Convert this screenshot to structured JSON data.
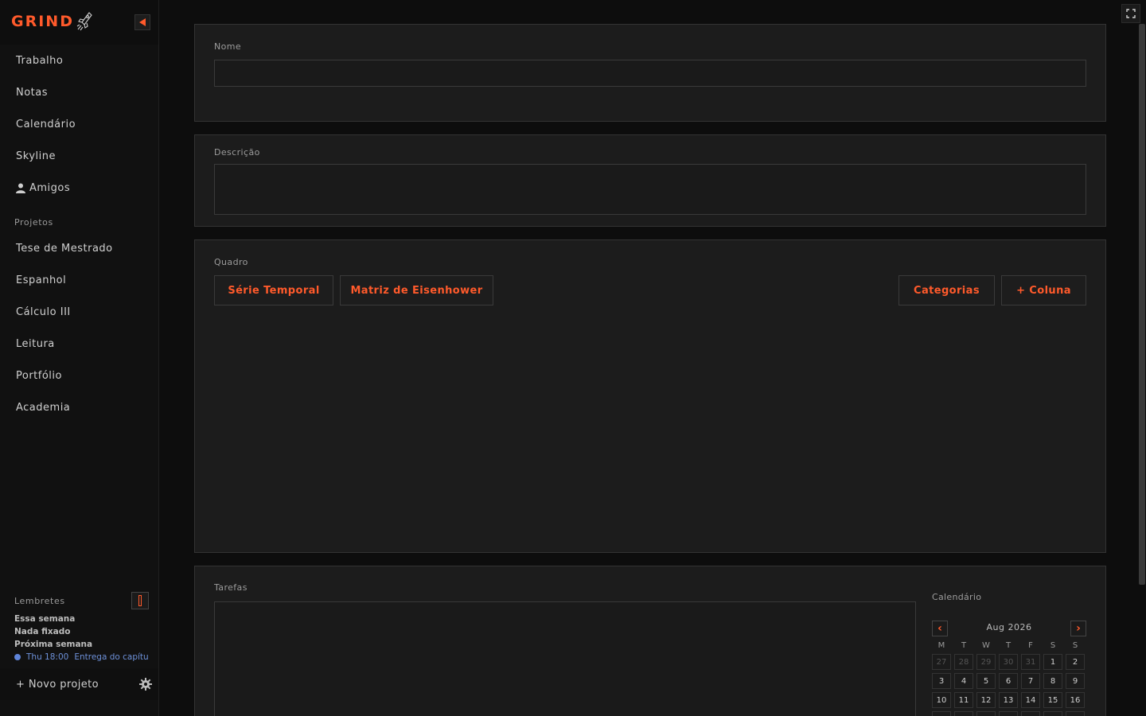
{
  "brand": {
    "name": "GRIND",
    "logo_icon": "rocket-logo-icon"
  },
  "sidebar": {
    "collapse_icon": "triangle-left-icon",
    "nav": [
      {
        "label": "Trabalho"
      },
      {
        "label": "Notas"
      },
      {
        "label": "Calendário"
      },
      {
        "label": "Skyline"
      },
      {
        "label": "Amigos",
        "icon": "person-icon"
      }
    ],
    "projects_label": "Projetos",
    "projects": [
      {
        "label": "Tese de Mestrado"
      },
      {
        "label": "Espanhol"
      },
      {
        "label": "Cálculo III"
      },
      {
        "label": "Leitura"
      },
      {
        "label": "Portfólio"
      },
      {
        "label": "Academia"
      }
    ],
    "reminders": {
      "title": "Lembretes",
      "this_week": "Essa semana",
      "nothing_pinned": "Nada fixado",
      "next_week": "Próxima semana",
      "event": {
        "time": "Thu 18:00",
        "text": "Entrega do capítulo"
      }
    },
    "new_project_label": "+ Novo projeto"
  },
  "main": {
    "name_card": {
      "label": "Nome",
      "value": ""
    },
    "description_card": {
      "label": "Descrição",
      "value": ""
    },
    "board": {
      "label": "Quadro",
      "left_buttons": [
        "Série Temporal",
        "Matriz de Eisenhower"
      ],
      "right_buttons": [
        "Categorias",
        "+ Coluna"
      ]
    },
    "tasks": {
      "label": "Tarefas",
      "calendar": {
        "label": "Calendário",
        "month": "Aug 2026",
        "prev": "‹",
        "next": "›",
        "weekdays": [
          "M",
          "T",
          "W",
          "T",
          "F",
          "S",
          "S"
        ],
        "weeks": [
          [
            "27",
            "28",
            "29",
            "30",
            "31",
            "1",
            "2"
          ],
          [
            "3",
            "4",
            "5",
            "6",
            "7",
            "8",
            "9"
          ],
          [
            "10",
            "11",
            "12",
            "13",
            "14",
            "15",
            "16"
          ]
        ],
        "muted_days_first_week": 5
      }
    }
  },
  "colors": {
    "accent": "#ff5a2b",
    "event": "#5f84d9",
    "background": "#0d0d0d",
    "card": "#1c1c1c"
  }
}
